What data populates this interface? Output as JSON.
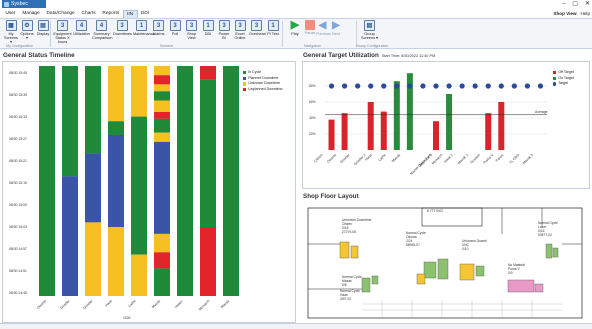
{
  "window": {
    "title": "Sysbec Process Control System",
    "controls": [
      "–",
      "▢",
      "✕"
    ]
  },
  "menu": {
    "items": [
      "User",
      "Manage",
      "Data/Change",
      "Charts",
      "Reports",
      "IIN",
      "DDI"
    ],
    "active_index": 5,
    "right_items": [
      "Shop View",
      "Help"
    ]
  },
  "ribbon": {
    "buttons": [
      {
        "id": "my-screens",
        "label": "My Screens ▾",
        "glyph": "▦"
      },
      {
        "id": "options",
        "label": "Options ▾",
        "glyph": "⚙"
      },
      {
        "id": "display",
        "label": "Display",
        "glyph": "▤"
      },
      {
        "id": "equipment-status",
        "label": "Equipment Status X hours",
        "glyph": "3"
      },
      {
        "id": "utilization",
        "label": "Utilization",
        "glyph": "4"
      },
      {
        "id": "summary-comparison",
        "label": "Summary Comparison",
        "glyph": "4"
      },
      {
        "id": "downtimes",
        "label": "Downtimes",
        "glyph": "3"
      },
      {
        "id": "maintenance",
        "label": "Maintenance",
        "glyph": "1"
      },
      {
        "id": "alarms",
        "label": "Alarms",
        "glyph": "3"
      },
      {
        "id": "poll",
        "label": "Poll",
        "glyph": "3"
      },
      {
        "id": "shop-view",
        "label": "Shop View",
        "glyph": "3"
      },
      {
        "id": "ddi",
        "label": "DDI",
        "glyph": "1"
      },
      {
        "id": "power-bi",
        "label": "Power BI",
        "glyph": "3"
      },
      {
        "id": "excel-online",
        "label": "Excel Online",
        "glyph": "3"
      },
      {
        "id": "overhead",
        "label": "Overhead",
        "glyph": "3"
      },
      {
        "id": "pi-test",
        "label": "PI Test",
        "glyph": "1"
      },
      {
        "id": "play",
        "label": "Play",
        "glyph": "▶"
      },
      {
        "id": "pause",
        "label": "Pause",
        "glyph": ""
      },
      {
        "id": "previous",
        "label": "Previous",
        "glyph": "◀"
      },
      {
        "id": "next",
        "label": "Next",
        "glyph": "▶"
      },
      {
        "id": "group-screens",
        "label": "Group Screens ▾",
        "glyph": "▤"
      }
    ],
    "groups": [
      "My Configuration",
      "Screens",
      "Navigation",
      "Group Configuration"
    ]
  },
  "timeline": {
    "title": "General Status Timeline",
    "time_labels": [
      "08/30 15:45",
      "08/30 15:39",
      "08/30 15:33",
      "08/30 15:27",
      "08/30 15:21",
      "08/30 15:15",
      "08/30 15:09",
      "08/30 15:03",
      "08/30 14:57",
      "08/30 14:51",
      "08/30 14:45"
    ],
    "legend": [
      {
        "label": "In Cycle",
        "color": "#1f8a3a"
      },
      {
        "label": "Planned Downtime",
        "color": "#3a55a8"
      },
      {
        "label": "Unknown Downtime",
        "color": "#f6bf22"
      },
      {
        "label": "Unplanned Downtime",
        "color": "#e3242b"
      }
    ],
    "machines": [
      {
        "name": "Okuma",
        "segments": [
          [
            "g",
            100
          ]
        ]
      },
      {
        "name": "Grinder",
        "segments": [
          [
            "g",
            48
          ],
          [
            "b",
            52
          ]
        ]
      },
      {
        "name": "Grinder",
        "segments": [
          [
            "g",
            38
          ],
          [
            "b",
            30
          ],
          [
            "y",
            32
          ]
        ]
      },
      {
        "name": "Haas",
        "segments": [
          [
            "y",
            24
          ],
          [
            "g",
            6
          ],
          [
            "b",
            40
          ],
          [
            "y",
            30
          ]
        ]
      },
      {
        "name": "Lathe",
        "segments": [
          [
            "y",
            22
          ],
          [
            "g",
            60
          ],
          [
            "y",
            18
          ]
        ]
      },
      {
        "name": "Mazak",
        "segments": [
          [
            "y",
            4
          ],
          [
            "r",
            4
          ],
          [
            "y",
            3
          ],
          [
            "g",
            4
          ],
          [
            "y",
            5
          ],
          [
            "r",
            3
          ],
          [
            "g",
            6
          ],
          [
            "y",
            4
          ],
          [
            "b",
            40
          ],
          [
            "y",
            8
          ],
          [
            "r",
            7
          ],
          [
            "g",
            12
          ]
        ]
      },
      {
        "name": "Haas+",
        "segments": [
          [
            "g",
            100
          ]
        ]
      },
      {
        "name": "Monarch",
        "segments": [
          [
            "r",
            6
          ],
          [
            "g",
            64
          ],
          [
            "r",
            30
          ]
        ]
      },
      {
        "name": "Mazak",
        "segments": [
          [
            "g",
            100
          ]
        ]
      }
    ],
    "footer": "1030"
  },
  "utilization": {
    "title": "General Target Utilization",
    "subtitle": "Start Time: 8/30/2022 11:40 PM",
    "legend": [
      {
        "label": "Off Target",
        "color": "#d7262b"
      },
      {
        "label": "On Target",
        "color": "#2a8b3c"
      },
      {
        "label": "Target",
        "color": "#2c4a9c"
      }
    ],
    "average_label": "Average"
  },
  "chart_data": {
    "type": "bar",
    "title": "General Target Utilization",
    "categories": [
      "Citizen",
      "Okuma",
      "Grinder",
      "Grinder 2",
      "Haas",
      "Lathe",
      "Mazak",
      "Mazak Quick Turn",
      "Machine 9",
      "Monarch",
      "Haas 2",
      "Mazak 2",
      "Doosan",
      "Puma V",
      "Fanuc",
      "TL DDD",
      "Mazak 3"
    ],
    "series": [
      {
        "name": "Off Target",
        "values": [
          38,
          46,
          0,
          60,
          48,
          0,
          0,
          0,
          36,
          0,
          0,
          0,
          46,
          60,
          0,
          0,
          0
        ]
      },
      {
        "name": "On Target",
        "values": [
          0,
          0,
          0,
          0,
          0,
          86,
          96,
          0,
          0,
          70,
          0,
          0,
          0,
          0,
          0,
          0,
          0
        ]
      },
      {
        "name": "Target",
        "values": [
          80,
          80,
          80,
          80,
          80,
          80,
          80,
          80,
          80,
          80,
          80,
          80,
          80,
          80,
          80,
          80,
          80
        ]
      }
    ],
    "average": 44,
    "ylim": [
      0,
      100
    ],
    "yticks": [
      "20%",
      "40%",
      "60%",
      "80%"
    ]
  },
  "floor": {
    "title": "Shop Floor Layout",
    "kitting_label": "KITTING",
    "labels": [
      {
        "id": "citizen",
        "text": "Unknown Downtime\nCitizen\n0/18\n27279-08"
      },
      {
        "id": "okuma",
        "text": "Normal Cycle\nOkuma\n2/24\n88945-07"
      },
      {
        "id": "grinder",
        "text": "Unknown Downti\nVNC\n0/10"
      },
      {
        "id": "lathe",
        "text": "Normal Cycle\nLaser\n0/16\n53577-02"
      },
      {
        "id": "puma",
        "text": "No Material\nPuma V\n0/0"
      },
      {
        "id": "mazak",
        "text": "Normal Cycle\nMazak\n0/8"
      },
      {
        "id": "haas",
        "text": "Normal Cycle\nHaas\n3/97-02"
      }
    ]
  },
  "status_bar": {
    "left": "",
    "center": "1030"
  }
}
